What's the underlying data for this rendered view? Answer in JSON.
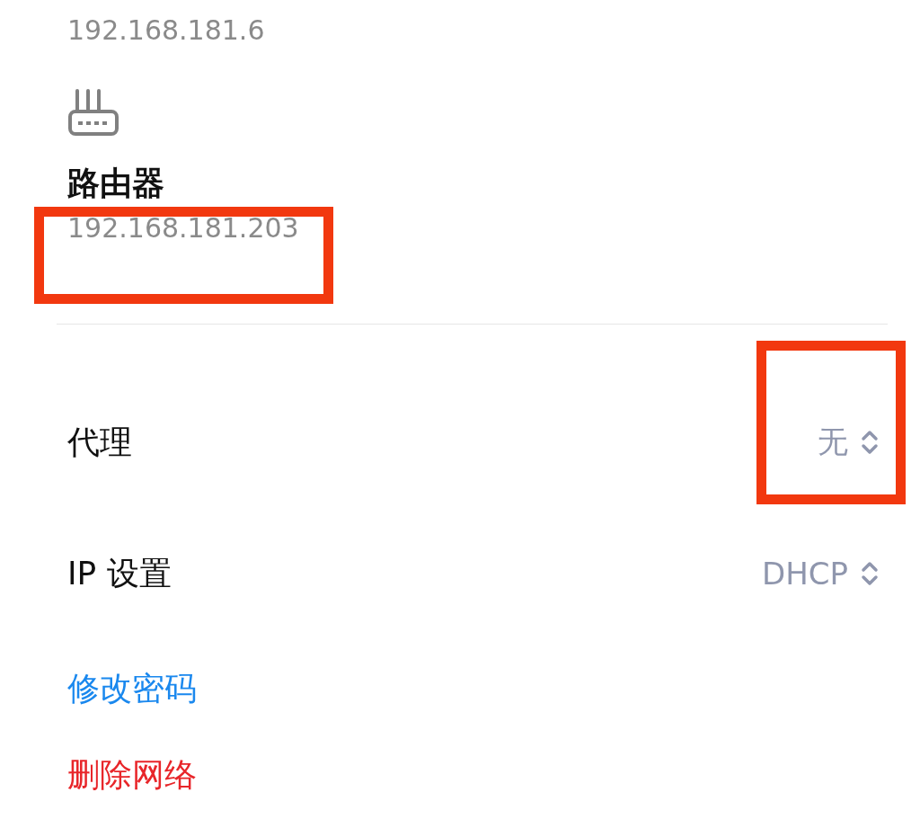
{
  "device_ip": "192.168.181.6",
  "router": {
    "label": "路由器",
    "ip": "192.168.181.203",
    "highlighted": true
  },
  "settings": [
    {
      "label": "代理",
      "value": "无",
      "highlighted": true
    },
    {
      "label": "IP 设置",
      "value": "DHCP",
      "highlighted": false
    }
  ],
  "actions": [
    {
      "label": "修改密码",
      "kind": "link"
    },
    {
      "label": "删除网络",
      "kind": "danger"
    }
  ]
}
